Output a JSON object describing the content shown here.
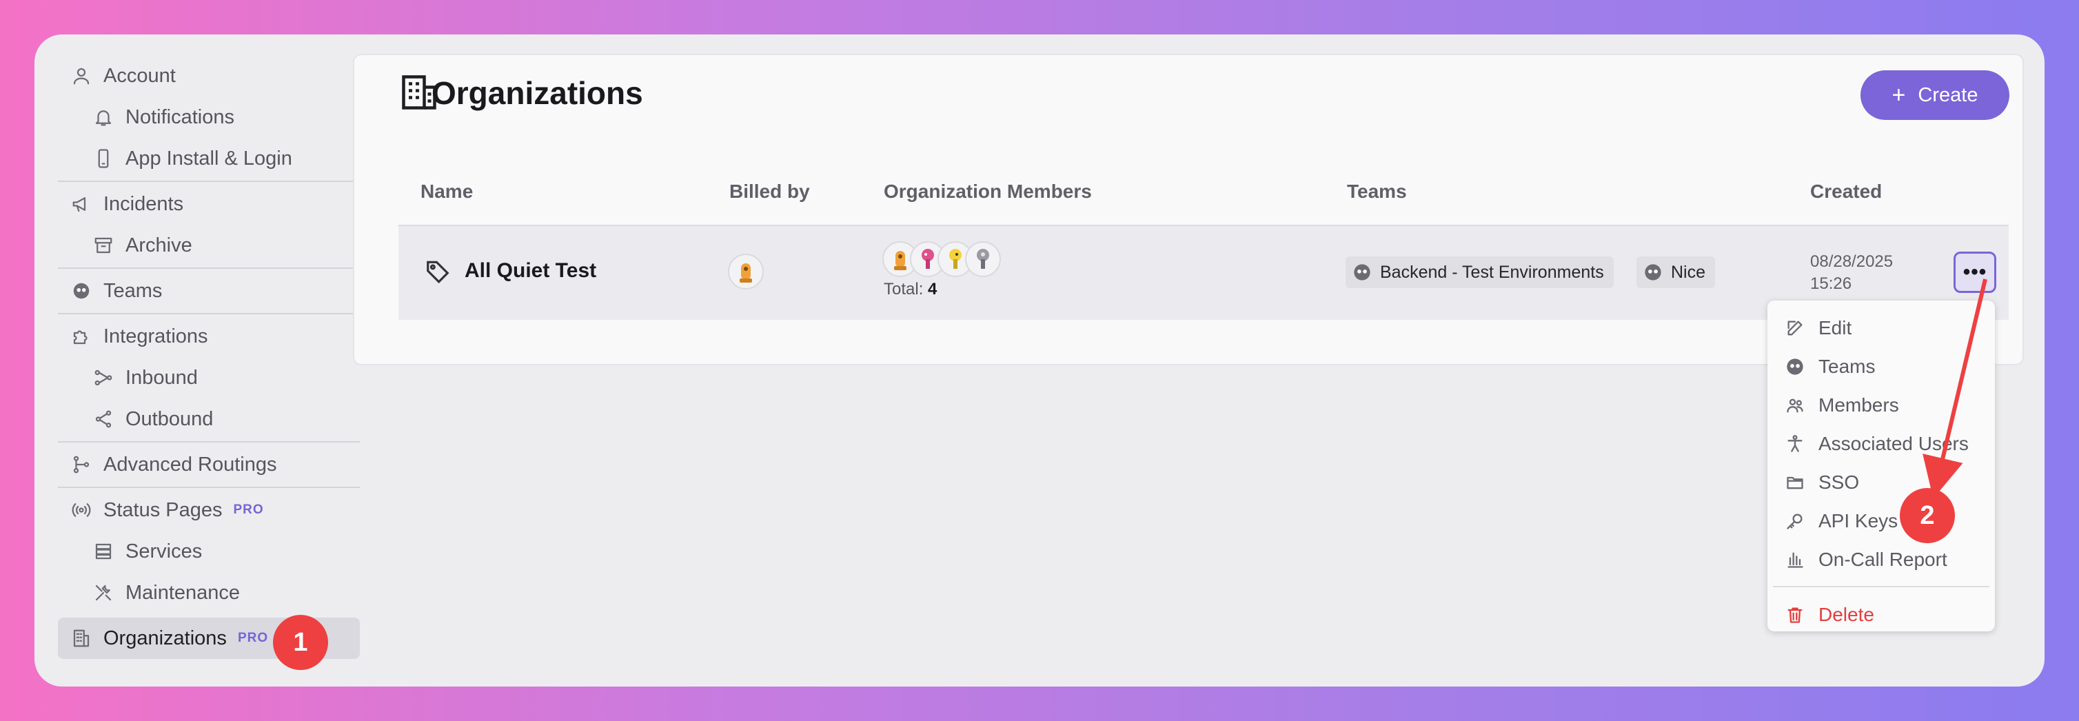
{
  "sidebar": {
    "account": "Account",
    "notifications": "Notifications",
    "app_install": "App Install & Login",
    "incidents": "Incidents",
    "archive": "Archive",
    "teams": "Teams",
    "integrations": "Integrations",
    "inbound": "Inbound",
    "outbound": "Outbound",
    "advanced_routings": "Advanced Routings",
    "status_pages": "Status Pages",
    "status_pages_badge": "PRO",
    "services": "Services",
    "maintenance": "Maintenance",
    "organizations": "Organizations",
    "organizations_badge": "PRO"
  },
  "annotations": {
    "step1": "1",
    "step2": "2"
  },
  "header": {
    "title": "Organizations",
    "create_label": "Create"
  },
  "table": {
    "columns": [
      "Name",
      "Billed by",
      "Organization Members",
      "Teams",
      "Created"
    ],
    "rows": [
      {
        "name": "All Quiet Test",
        "total_label": "Total:",
        "total_value": "4",
        "teams": [
          "Backend - Test Environments",
          "Nice"
        ],
        "created_date": "08/28/2025",
        "created_time": "15:26"
      }
    ],
    "more_label": "•••"
  },
  "menu": {
    "items": [
      "Edit",
      "Teams",
      "Members",
      "Associated Users",
      "SSO",
      "API Keys",
      "On-Call Report"
    ],
    "delete": "Delete"
  },
  "colors": {
    "accent": "#7b65d8",
    "danger": "#e53e3e",
    "annotation": "#ee4040"
  }
}
